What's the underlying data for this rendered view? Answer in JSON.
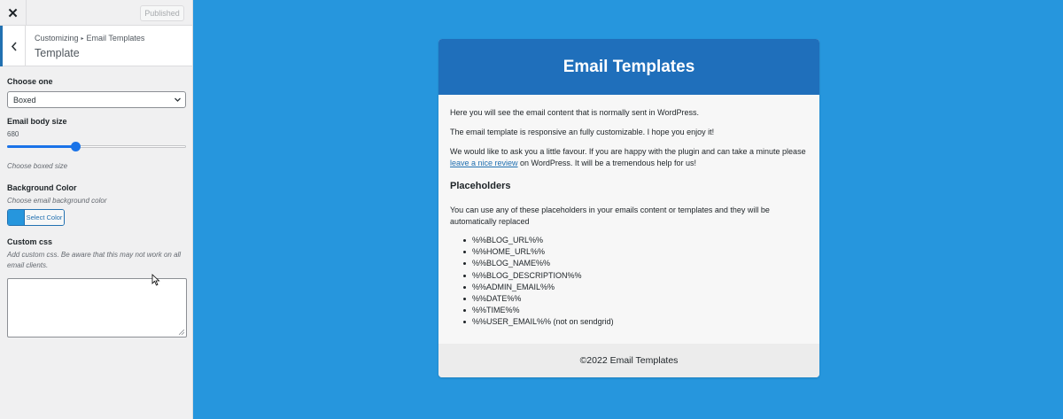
{
  "topbar": {
    "close_glyph": "✕",
    "publish_label": "Published"
  },
  "section": {
    "breadcrumb_parent": "Customizing",
    "breadcrumb_sep": "▸",
    "breadcrumb_current": "Email Templates",
    "title": "Template"
  },
  "controls": {
    "layout": {
      "label": "Choose one",
      "selected": "Boxed"
    },
    "body_size": {
      "label": "Email body size",
      "value": "680",
      "description": "Choose boxed size",
      "fill_fraction": 0.38
    },
    "background": {
      "label": "Background Color",
      "description": "Choose email background color",
      "button_label": "Select Color",
      "swatch_color": "#2696dd"
    },
    "custom_css": {
      "label": "Custom css",
      "description": "Add custom css. Be aware that this may not work on all email clients.",
      "value": ""
    }
  },
  "preview": {
    "background_color": "#2696dd",
    "header_color": "#1f6fbb",
    "header_title": "Email Templates",
    "para1": "Here you will see the email content that is normally sent in WordPress.",
    "para2": "The email template is responsive an fully customizable. I hope you enjoy it!",
    "para3_before": "We would like to ask you a little favour. If you are happy with the plugin and can take a minute please ",
    "para3_link": "leave a nice review",
    "para3_after": " on WordPress. It will be a tremendous help for us!",
    "placeholders_title": "Placeholders",
    "placeholders_intro": "You can use any of these placeholders in your emails content or templates and they will be automatically replaced",
    "placeholders": [
      "%%BLOG_URL%%",
      "%%HOME_URL%%",
      "%%BLOG_NAME%%",
      "%%BLOG_DESCRIPTION%%",
      "%%ADMIN_EMAIL%%",
      "%%DATE%%",
      "%%TIME%%",
      "%%USER_EMAIL%% (not on sendgrid)"
    ],
    "footer": "©2022 Email Templates"
  }
}
